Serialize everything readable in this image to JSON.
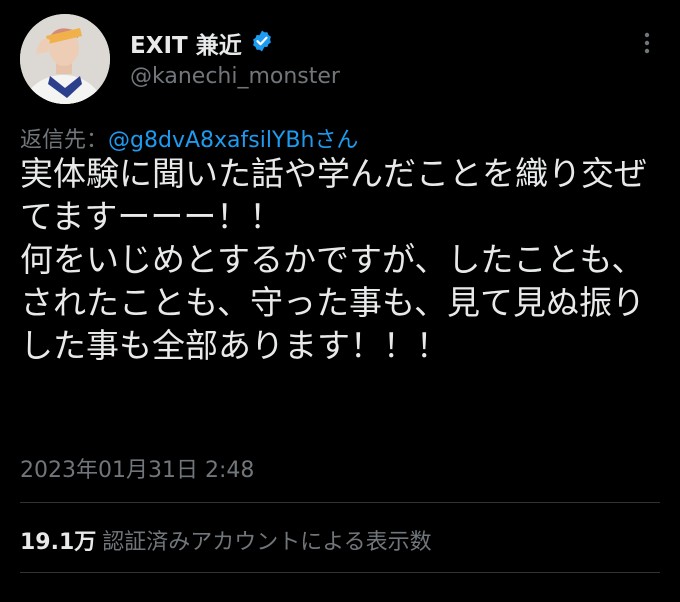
{
  "author": {
    "display_name": "EXIT 兼近",
    "handle": "@kanechi_monster",
    "verified": true
  },
  "reply": {
    "prefix": "返信先：",
    "target": "@g8dvA8xafsilYBhさん"
  },
  "tweet": {
    "text": "実体験に聞いた話や学んだことを織り交ぜてますーーー！！\n何をいじめとするかですが、したことも、されたことも、守った事も、見て見ぬ振りした事も全部あります！！！"
  },
  "timestamp": "2023年01月31日 2:48",
  "views": {
    "count": "19.1万",
    "label": "認証済みアカウントによる表示数"
  },
  "icons": {
    "verified": "verified-badge-icon",
    "more": "more-options-icon"
  },
  "colors": {
    "background": "#000000",
    "text": "#e7e9ea",
    "muted": "#71767b",
    "accent": "#1d9bf0",
    "divider": "#2f3336"
  }
}
